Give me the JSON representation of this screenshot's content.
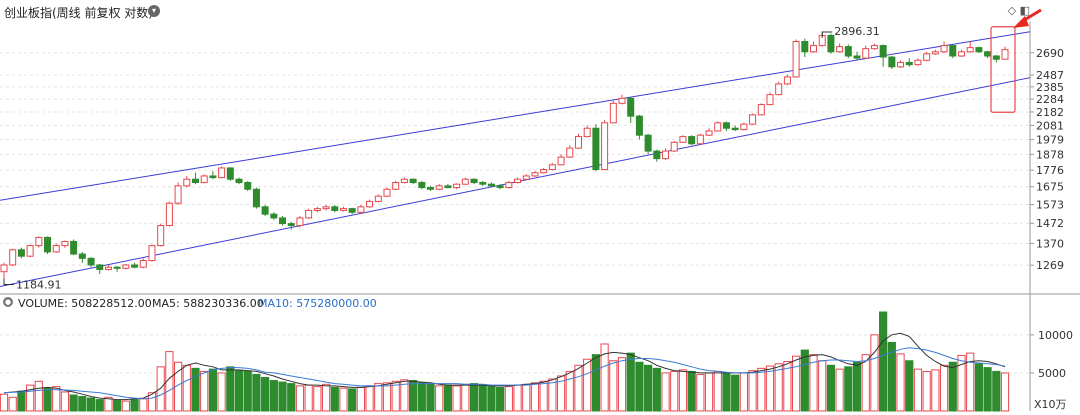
{
  "header": {
    "title": "创业板指(周线 前复权 对数)",
    "dropdown_icon": "chevron-down-icon",
    "corner_icons": [
      "diamond-icon",
      "panel-icon"
    ]
  },
  "volume_bar": {
    "label": "VOLUME: 508228512.00",
    "ma5": "MA5: 588230336.00",
    "ma10": "MA10: 575280000.00"
  },
  "annotations": {
    "high": "2896.31",
    "low": "1184.91"
  },
  "colors": {
    "up": "#e8474d",
    "down": "#2e8b2e",
    "channel": "#3a3ad8",
    "ma5": "#333333",
    "ma10": "#3a7bd5",
    "highlight": "#e8474d",
    "arrow": "#e8281e"
  },
  "chart_data": [
    {
      "type": "candlestick",
      "scale": "log",
      "y_ticks": [
        1269,
        1370,
        1472,
        1573,
        1675,
        1776,
        1878,
        1979,
        2081,
        2182,
        2284,
        2385,
        2487,
        2690
      ],
      "ylim": [
        1150,
        3000
      ],
      "candles": [
        [
          1240,
          1270,
          1184.91,
          1280
        ],
        [
          1270,
          1340,
          1265,
          1345
        ],
        [
          1340,
          1310,
          1300,
          1350
        ],
        [
          1310,
          1360,
          1305,
          1365
        ],
        [
          1360,
          1400,
          1350,
          1405
        ],
        [
          1400,
          1330,
          1320,
          1405
        ],
        [
          1330,
          1360,
          1325,
          1370
        ],
        [
          1360,
          1380,
          1350,
          1385
        ],
        [
          1380,
          1320,
          1315,
          1390
        ],
        [
          1320,
          1300,
          1280,
          1330
        ],
        [
          1300,
          1270,
          1260,
          1305
        ],
        [
          1270,
          1250,
          1230,
          1275
        ],
        [
          1250,
          1260,
          1245,
          1270
        ],
        [
          1260,
          1255,
          1240,
          1265
        ],
        [
          1255,
          1270,
          1250,
          1275
        ],
        [
          1270,
          1260,
          1255,
          1280
        ],
        [
          1260,
          1290,
          1255,
          1300
        ],
        [
          1290,
          1360,
          1285,
          1365
        ],
        [
          1360,
          1460,
          1355,
          1470
        ],
        [
          1460,
          1580,
          1455,
          1590
        ],
        [
          1580,
          1680,
          1570,
          1700
        ],
        [
          1680,
          1720,
          1670,
          1740
        ],
        [
          1720,
          1700,
          1690,
          1760
        ],
        [
          1700,
          1740,
          1695,
          1750
        ],
        [
          1740,
          1730,
          1720,
          1770
        ],
        [
          1730,
          1790,
          1725,
          1800
        ],
        [
          1790,
          1720,
          1710,
          1795
        ],
        [
          1720,
          1700,
          1690,
          1730
        ],
        [
          1700,
          1660,
          1650,
          1710
        ],
        [
          1660,
          1560,
          1550,
          1670
        ],
        [
          1560,
          1520,
          1510,
          1570
        ],
        [
          1520,
          1500,
          1490,
          1530
        ],
        [
          1500,
          1470,
          1460,
          1510
        ],
        [
          1470,
          1460,
          1440,
          1480
        ],
        [
          1460,
          1500,
          1450,
          1510
        ],
        [
          1500,
          1540,
          1495,
          1550
        ],
        [
          1540,
          1550,
          1530,
          1560
        ],
        [
          1550,
          1560,
          1540,
          1570
        ],
        [
          1560,
          1540,
          1530,
          1570
        ],
        [
          1540,
          1550,
          1535,
          1560
        ],
        [
          1550,
          1530,
          1520,
          1555
        ],
        [
          1530,
          1560,
          1520,
          1570
        ],
        [
          1560,
          1590,
          1555,
          1600
        ],
        [
          1590,
          1620,
          1585,
          1630
        ],
        [
          1620,
          1660,
          1615,
          1670
        ],
        [
          1660,
          1700,
          1655,
          1710
        ],
        [
          1700,
          1720,
          1695,
          1730
        ],
        [
          1720,
          1700,
          1690,
          1725
        ],
        [
          1700,
          1670,
          1660,
          1710
        ],
        [
          1670,
          1660,
          1650,
          1680
        ],
        [
          1660,
          1680,
          1655,
          1690
        ],
        [
          1680,
          1670,
          1665,
          1690
        ],
        [
          1670,
          1690,
          1660,
          1695
        ],
        [
          1690,
          1720,
          1685,
          1730
        ],
        [
          1720,
          1700,
          1690,
          1725
        ],
        [
          1700,
          1690,
          1680,
          1710
        ],
        [
          1690,
          1680,
          1670,
          1700
        ],
        [
          1680,
          1670,
          1660,
          1690
        ],
        [
          1670,
          1700,
          1665,
          1710
        ],
        [
          1700,
          1720,
          1695,
          1730
        ],
        [
          1720,
          1740,
          1715,
          1750
        ],
        [
          1740,
          1760,
          1735,
          1770
        ],
        [
          1760,
          1780,
          1755,
          1790
        ],
        [
          1780,
          1810,
          1775,
          1820
        ],
        [
          1810,
          1860,
          1805,
          1880
        ],
        [
          1860,
          1920,
          1855,
          1940
        ],
        [
          1920,
          2000,
          1915,
          2020
        ],
        [
          2000,
          2060,
          1995,
          2080
        ],
        [
          2060,
          1780,
          1770,
          2090
        ],
        [
          1780,
          2100,
          1775,
          2120
        ],
        [
          2100,
          2250,
          2095,
          2270
        ],
        [
          2250,
          2290,
          2240,
          2320
        ],
        [
          2290,
          2150,
          2100,
          2300
        ],
        [
          2150,
          2010,
          1980,
          2160
        ],
        [
          2010,
          1900,
          1880,
          2020
        ],
        [
          1900,
          1850,
          1830,
          1910
        ],
        [
          1850,
          1900,
          1840,
          1920
        ],
        [
          1900,
          1960,
          1895,
          1970
        ],
        [
          1960,
          2000,
          1955,
          2010
        ],
        [
          2000,
          1950,
          1940,
          2010
        ],
        [
          1950,
          2010,
          1945,
          2020
        ],
        [
          2010,
          2040,
          2005,
          2060
        ],
        [
          2040,
          2100,
          2035,
          2110
        ],
        [
          2100,
          2060,
          2040,
          2110
        ],
        [
          2060,
          2050,
          2040,
          2080
        ],
        [
          2050,
          2090,
          2045,
          2100
        ],
        [
          2090,
          2160,
          2085,
          2170
        ],
        [
          2160,
          2240,
          2155,
          2250
        ],
        [
          2240,
          2320,
          2235,
          2340
        ],
        [
          2320,
          2410,
          2315,
          2430
        ],
        [
          2410,
          2470,
          2400,
          2490
        ],
        [
          2470,
          2800,
          2465,
          2820
        ],
        [
          2800,
          2700,
          2650,
          2830
        ],
        [
          2700,
          2760,
          2690,
          2800
        ],
        [
          2760,
          2860,
          2750,
          2896.31
        ],
        [
          2860,
          2700,
          2680,
          2880
        ],
        [
          2700,
          2750,
          2690,
          2780
        ],
        [
          2750,
          2660,
          2640,
          2770
        ],
        [
          2660,
          2640,
          2620,
          2700
        ],
        [
          2640,
          2730,
          2630,
          2760
        ],
        [
          2730,
          2760,
          2720,
          2780
        ],
        [
          2760,
          2650,
          2560,
          2770
        ],
        [
          2650,
          2560,
          2540,
          2660
        ],
        [
          2560,
          2600,
          2550,
          2620
        ],
        [
          2600,
          2580,
          2560,
          2640
        ],
        [
          2580,
          2620,
          2570,
          2640
        ],
        [
          2620,
          2680,
          2610,
          2700
        ],
        [
          2680,
          2700,
          2670,
          2720
        ],
        [
          2700,
          2760,
          2690,
          2800
        ],
        [
          2760,
          2660,
          2640,
          2770
        ],
        [
          2660,
          2700,
          2650,
          2720
        ],
        [
          2700,
          2740,
          2690,
          2800
        ],
        [
          2740,
          2700,
          2690,
          2750
        ],
        [
          2700,
          2660,
          2640,
          2710
        ],
        [
          2660,
          2630,
          2600,
          2670
        ],
        [
          2630,
          2720,
          2625,
          2750
        ]
      ],
      "channel_upper": [
        [
          0,
          1600
        ],
        [
          111,
          2800
        ]
      ],
      "channel_lower": [
        [
          0,
          1180
        ],
        [
          111,
          2360
        ]
      ],
      "highlight_index": 115
    },
    {
      "type": "bar",
      "y_ticks": [
        5000,
        10000
      ],
      "unit": "X10万",
      "ylim": [
        0,
        13000
      ],
      "volumes": [
        2200,
        1800,
        2600,
        3400,
        3900,
        3000,
        3200,
        2500,
        2100,
        1900,
        1700,
        1500,
        1800,
        1400,
        1300,
        1500,
        1600,
        2400,
        5800,
        7800,
        6400,
        6000,
        5600,
        5200,
        5500,
        5000,
        5800,
        5300,
        5200,
        4800,
        4400,
        4000,
        3800,
        3600,
        3300,
        3400,
        3200,
        3500,
        3100,
        3000,
        2900,
        3100,
        3300,
        3600,
        3700,
        3900,
        4100,
        4000,
        3700,
        3500,
        3300,
        3400,
        3300,
        3500,
        3600,
        3400,
        3200,
        3100,
        3200,
        3400,
        3500,
        3700,
        3900,
        4200,
        4600,
        5200,
        6000,
        6800,
        7400,
        8800,
        6600,
        7000,
        7600,
        6400,
        6000,
        5600,
        5000,
        5200,
        5400,
        5200,
        4800,
        5000,
        5200,
        4900,
        4700,
        5000,
        5300,
        5600,
        5900,
        6200,
        6500,
        7200,
        8000,
        7400,
        6600,
        6000,
        5500,
        5800,
        6400,
        7400,
        10000,
        13000,
        9000,
        7500,
        6600,
        5500,
        5200,
        5400,
        6000,
        6400,
        7300,
        7600,
        6200,
        5700,
        5200,
        5000
      ],
      "volume_up": [
        true,
        true,
        false,
        true,
        true,
        false,
        true,
        true,
        false,
        false,
        false,
        false,
        true,
        false,
        true,
        false,
        true,
        true,
        true,
        true,
        true,
        true,
        false,
        true,
        false,
        true,
        false,
        false,
        false,
        false,
        false,
        false,
        false,
        false,
        true,
        true,
        true,
        true,
        false,
        true,
        false,
        true,
        true,
        true,
        true,
        true,
        true,
        false,
        false,
        false,
        true,
        false,
        true,
        true,
        false,
        false,
        false,
        false,
        true,
        true,
        true,
        true,
        true,
        true,
        true,
        true,
        true,
        true,
        false,
        true,
        true,
        true,
        false,
        false,
        false,
        false,
        true,
        true,
        true,
        false,
        true,
        true,
        true,
        false,
        false,
        true,
        true,
        true,
        true,
        true,
        true,
        true,
        false,
        true,
        true,
        false,
        true,
        false,
        false,
        true,
        true,
        false,
        false,
        true,
        false,
        true,
        true,
        true,
        true,
        false,
        true,
        true,
        false,
        false,
        false,
        true
      ],
      "ma5": [
        2400,
        2500,
        2600,
        2800,
        3000,
        3100,
        3000,
        2700,
        2500,
        2200,
        1900,
        1700,
        1600,
        1500,
        1500,
        1600,
        1700,
        2200,
        3000,
        4300,
        5200,
        6000,
        6300,
        6000,
        5800,
        5400,
        5400,
        5400,
        5300,
        5200,
        4900,
        4600,
        4200,
        3900,
        3600,
        3400,
        3400,
        3300,
        3300,
        3200,
        3100,
        3100,
        3200,
        3300,
        3500,
        3700,
        3900,
        3900,
        3800,
        3700,
        3500,
        3400,
        3400,
        3400,
        3400,
        3400,
        3300,
        3300,
        3300,
        3400,
        3500,
        3600,
        3800,
        4100,
        4500,
        5000,
        5600,
        6300,
        7000,
        7500,
        7700,
        7600,
        7400,
        7000,
        6600,
        6000,
        5600,
        5300,
        5200,
        5100,
        5000,
        5000,
        5000,
        5000,
        5000,
        5000,
        5100,
        5300,
        5500,
        5800,
        6200,
        6700,
        7100,
        7300,
        7400,
        7100,
        6600,
        6200,
        6000,
        6500,
        7700,
        9200,
        10000,
        10200,
        9800,
        8500,
        7300,
        6500,
        5900,
        5700,
        6100,
        6500,
        6600,
        6500,
        6200,
        5800
      ],
      "ma10": [
        2400,
        2450,
        2500,
        2600,
        2700,
        2800,
        2800,
        2750,
        2700,
        2600,
        2500,
        2400,
        2200,
        2000,
        1800,
        1700,
        1600,
        1700,
        2100,
        2700,
        3400,
        4000,
        4500,
        5000,
        5400,
        5600,
        5700,
        5700,
        5600,
        5400,
        5100,
        5000,
        4800,
        4600,
        4400,
        4200,
        4000,
        3800,
        3600,
        3500,
        3400,
        3300,
        3300,
        3300,
        3300,
        3400,
        3500,
        3600,
        3600,
        3600,
        3600,
        3600,
        3600,
        3500,
        3500,
        3500,
        3400,
        3400,
        3400,
        3400,
        3400,
        3500,
        3600,
        3700,
        3900,
        4200,
        4500,
        4900,
        5400,
        5900,
        6300,
        6600,
        6800,
        6900,
        6900,
        6800,
        6600,
        6400,
        6100,
        5800,
        5500,
        5300,
        5200,
        5100,
        5000,
        5000,
        5000,
        5100,
        5200,
        5400,
        5600,
        5800,
        6100,
        6400,
        6600,
        6700,
        6700,
        6600,
        6500,
        6600,
        6900,
        7300,
        7700,
        8100,
        8300,
        8200,
        8000,
        7700,
        7300,
        6900,
        6600,
        6400,
        6300,
        6200,
        6100,
        5900
      ]
    }
  ]
}
